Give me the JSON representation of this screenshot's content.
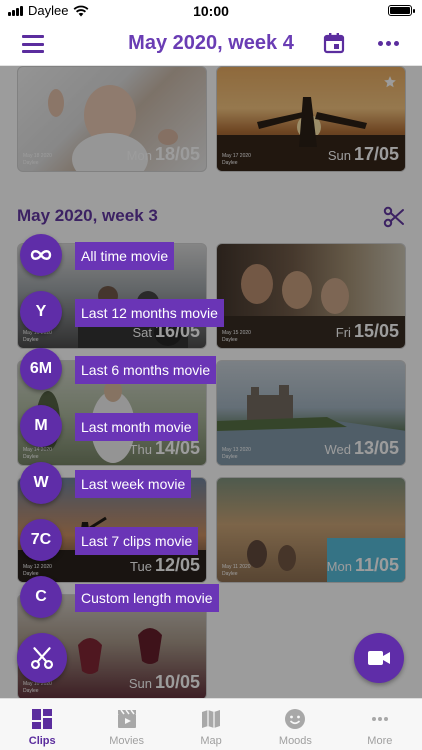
{
  "status_bar": {
    "carrier": "Daylee",
    "time": "10:00"
  },
  "header": {
    "title": "May 2020, week 4"
  },
  "clips": [
    {
      "meta_date": "May 18 2020",
      "meta_app": "Daylee",
      "weekday": "Mon",
      "date": "18/05"
    },
    {
      "meta_date": "May 17 2020",
      "meta_app": "Daylee",
      "weekday": "Sun",
      "date": "17/05"
    },
    {
      "meta_date": "May 16 2020",
      "meta_app": "Daylee",
      "weekday": "Sat",
      "date": "16/05"
    },
    {
      "meta_date": "May 15 2020",
      "meta_app": "Daylee",
      "weekday": "Fri",
      "date": "15/05"
    },
    {
      "meta_date": "May 14 2020",
      "meta_app": "Daylee",
      "weekday": "Thu",
      "date": "14/05"
    },
    {
      "meta_date": "May 13 2020",
      "meta_app": "Daylee",
      "weekday": "Wed",
      "date": "13/05"
    },
    {
      "meta_date": "May 12 2020",
      "meta_app": "Daylee",
      "weekday": "Tue",
      "date": "12/05"
    },
    {
      "meta_date": "May 11 2020",
      "meta_app": "Daylee",
      "weekday": "Mon",
      "date": "11/05"
    },
    {
      "meta_date": "May 10 2020",
      "meta_app": "Daylee",
      "weekday": "Sun",
      "date": "10/05"
    }
  ],
  "section": {
    "heading": "May 2020, week 3"
  },
  "speed_dial": [
    {
      "badge": "∞",
      "label": "All time movie"
    },
    {
      "badge": "Y",
      "label": "Last 12 months movie"
    },
    {
      "badge": "6M",
      "label": "Last 6 months movie"
    },
    {
      "badge": "M",
      "label": "Last month movie"
    },
    {
      "badge": "W",
      "label": "Last week movie"
    },
    {
      "badge": "7C",
      "label": "Last 7 clips movie"
    },
    {
      "badge": "C",
      "label": "Custom length movie"
    }
  ],
  "tabs": [
    {
      "label": "Clips",
      "icon": "clips-grid-icon",
      "active": true
    },
    {
      "label": "Movies",
      "icon": "clapperboard-icon",
      "active": false
    },
    {
      "label": "Map",
      "icon": "map-icon",
      "active": false
    },
    {
      "label": "Moods",
      "icon": "smiley-icon",
      "active": false
    },
    {
      "label": "More",
      "icon": "more-dots-icon",
      "active": false
    }
  ],
  "colors": {
    "accent": "#5f2da8",
    "accent_text": "#5b2d9e",
    "dim_overlay": "rgba(20,20,20,0.42)",
    "tab_inactive": "#a0a0a0"
  }
}
